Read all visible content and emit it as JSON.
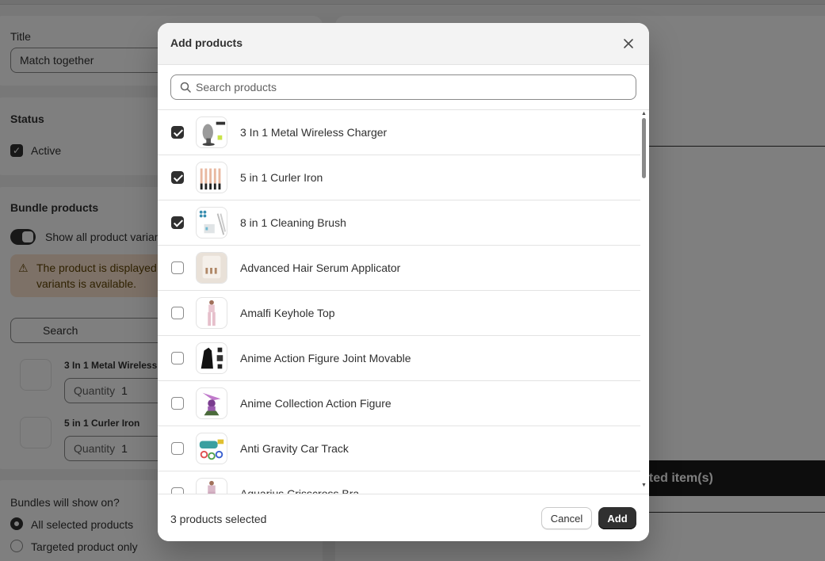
{
  "background": {
    "title_label": "Title",
    "title_value": "Match together",
    "status_label": "Status",
    "status_active_label": "Active",
    "bundle_heading": "Bundle products",
    "show_all_variants_label": "Show all product varian",
    "banner_text": "The product is displayed variants is available.",
    "search_placeholder": "Search",
    "bundle_items": [
      {
        "name": "3 In 1 Metal Wireless",
        "qty_label": "Quantity",
        "qty": "1"
      },
      {
        "name": "5 in 1 Curler Iron",
        "qty_label": "Quantity",
        "qty": "1"
      }
    ],
    "bundles_show_on": "Bundles will show on?",
    "radio_all": "All selected products",
    "radio_targeted": "Targeted product only",
    "dark_bar_text": "cted item(s)"
  },
  "modal": {
    "title": "Add products",
    "search_placeholder": "Search products",
    "products": [
      {
        "name": "3 In 1 Metal Wireless Charger",
        "checked": true,
        "thumb": "charger"
      },
      {
        "name": "5 in 1 Curler Iron",
        "checked": true,
        "thumb": "curler"
      },
      {
        "name": "8 in 1 Cleaning Brush",
        "checked": true,
        "thumb": "brush"
      },
      {
        "name": "Advanced Hair Serum Applicator",
        "checked": false,
        "thumb": "serum"
      },
      {
        "name": "Amalfi Keyhole Top",
        "checked": false,
        "thumb": "top"
      },
      {
        "name": "Anime Action Figure Joint Movable",
        "checked": false,
        "thumb": "figure-dark"
      },
      {
        "name": "Anime Collection Action Figure",
        "checked": false,
        "thumb": "figure-purple"
      },
      {
        "name": "Anti Gravity Car Track",
        "checked": false,
        "thumb": "track"
      },
      {
        "name": "Aquarius Crisscross Bra",
        "checked": false,
        "thumb": "bra"
      }
    ],
    "footer": {
      "selected_text": "3 products selected",
      "cancel_label": "Cancel",
      "add_label": "Add"
    }
  },
  "colors": {
    "primary_button": "#303030",
    "overlay": "rgba(0,0,0,0.5)",
    "banner": "#fbe3cf"
  }
}
